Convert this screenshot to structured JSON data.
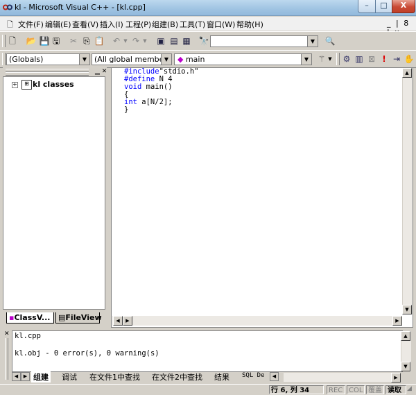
{
  "window": {
    "title": "kl - Microsoft Visual C++ - [kl.cpp]",
    "minimize": "–",
    "maximize": "□",
    "close": "X"
  },
  "menubar": {
    "items": [
      "文件(F)",
      "编辑(E)",
      "查看(V)",
      "插入(I)",
      "工程(P)",
      "组建(B)",
      "工具(T)",
      "窗口(W)",
      "帮助(H)"
    ],
    "mdi_controls": "_ | 8 | x"
  },
  "toolbar2": {
    "scope_combo": "(Globals)",
    "members_combo": "(All global members",
    "function_combo": "main"
  },
  "workspace": {
    "tree_root": "kl classes",
    "tabs": [
      "ClassV...",
      "FileView"
    ]
  },
  "editor": {
    "lines": [
      {
        "kw": "#include",
        "rest": "\"stdio.h\""
      },
      {
        "kw": "#define",
        "rest": " N 4"
      },
      {
        "kw": "void",
        "rest": " main()"
      },
      {
        "kw": "",
        "rest": "{"
      },
      {
        "kw": "int",
        "rest": " a[N/2];"
      },
      {
        "kw": "",
        "rest": "}"
      }
    ],
    "keyword_color": "#0000ff"
  },
  "output": {
    "lines": [
      "kl.cpp",
      "",
      "kl.obj - 0 error(s), 0 warning(s)"
    ],
    "tabs": [
      "组建",
      "调试",
      "在文件1中查找",
      "在文件2中查找",
      "结果",
      "SQL De"
    ]
  },
  "statusbar": {
    "position": "行 6, 列 34",
    "rec": "REC",
    "col": "COL",
    "ovr": "覆盖",
    "read": "读取"
  }
}
